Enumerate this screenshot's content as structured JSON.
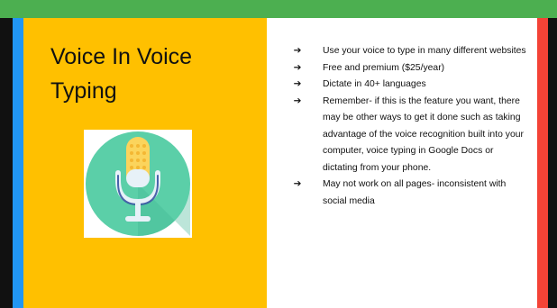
{
  "slide": {
    "title": "Voice In Voice Typing",
    "bullets": [
      "Use your voice to type in many different websites",
      "Free and premium ($25/year)",
      "Dictate in 40+ languages",
      "Remember- if this is the feature you want, there may be other ways to get it done such as taking advantage of the voice recognition built into your computer, voice typing in Google Docs or dictating from your phone.",
      "May not work on all pages- inconsistent with social media"
    ],
    "bullet_marker": "➔",
    "icon": "microphone-icon"
  },
  "colors": {
    "top_bar": "#4caf50",
    "left_stripe": "#2196f3",
    "left_panel": "#ffc000",
    "right_stripe": "#f44336",
    "icon_circle": "#5bcfa8"
  }
}
